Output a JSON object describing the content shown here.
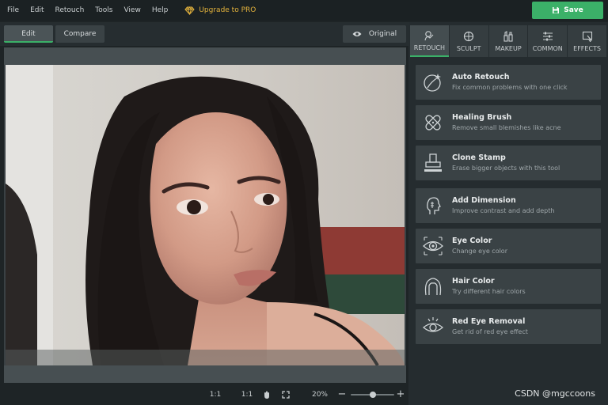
{
  "menu": [
    "File",
    "Edit",
    "Retouch",
    "Tools",
    "View",
    "Help"
  ],
  "upgrade_label": "Upgrade to PRO",
  "save_label": "Save",
  "view_tabs": {
    "edit": "Edit",
    "compare": "Compare"
  },
  "original_label": "Original",
  "zoom": {
    "ratio_a": "1:1",
    "ratio_b": "1:1",
    "level": "20%",
    "slider_fraction": 0.5
  },
  "panel_tabs": [
    "RETOUCH",
    "SCULPT",
    "MAKEUP",
    "COMMON",
    "EFFECTS"
  ],
  "tools": [
    {
      "title": "Auto Retouch",
      "desc": "Fix common problems with one click",
      "icon": "auto-retouch-icon"
    },
    {
      "title": "Healing Brush",
      "desc": "Remove small blemishes like acne",
      "icon": "bandage-icon"
    },
    {
      "title": "Clone Stamp",
      "desc": "Erase bigger objects with this tool",
      "icon": "stamp-icon"
    },
    {
      "title": "Add Dimension",
      "desc": "Improve contrast and add depth",
      "icon": "face-profile-icon"
    },
    {
      "title": "Eye Color",
      "desc": "Change eye color",
      "icon": "eye-icon"
    },
    {
      "title": "Hair Color",
      "desc": "Try different hair colors",
      "icon": "hair-icon"
    },
    {
      "title": "Red Eye Removal",
      "desc": "Get rid of red eye effect",
      "icon": "red-eye-icon"
    }
  ],
  "colors": {
    "accent": "#3bb068",
    "upgrade": "#e3b23c"
  },
  "watermark": "CSDN @mgccoons"
}
